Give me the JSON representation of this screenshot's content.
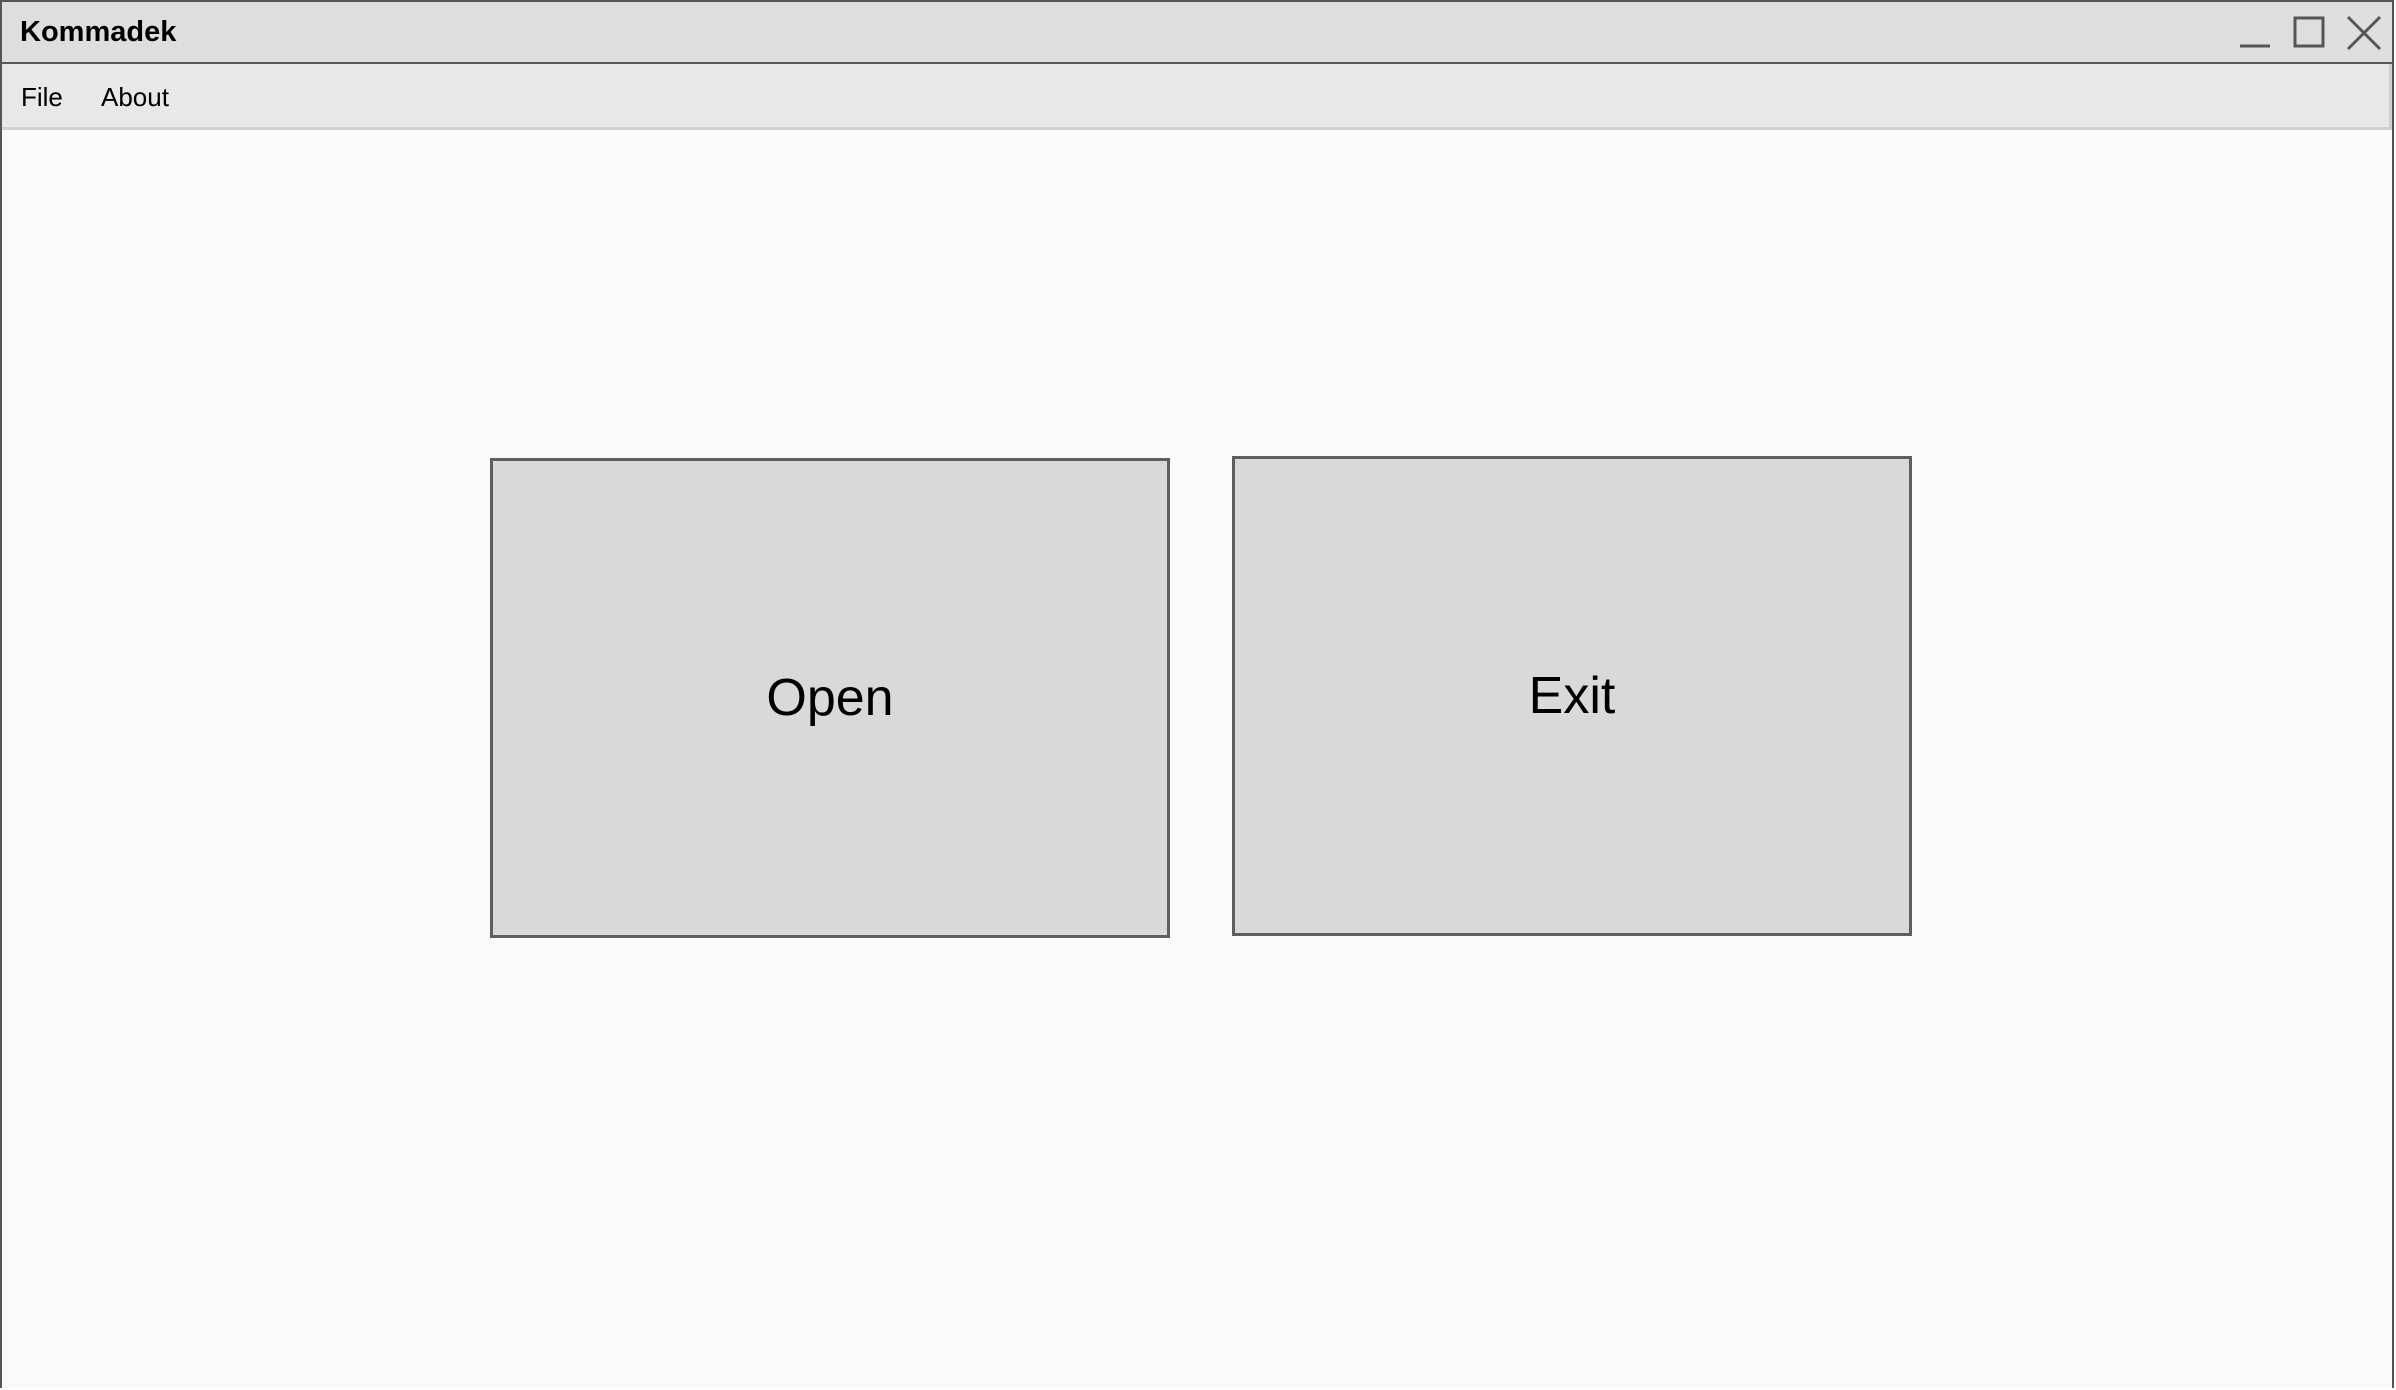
{
  "window": {
    "title": "Kommadek",
    "controls": {
      "minimize_icon": "minimize-icon",
      "maximize_icon": "maximize-icon",
      "close_icon": "close-icon"
    }
  },
  "menubar": {
    "items": [
      {
        "label": "File"
      },
      {
        "label": "About"
      }
    ]
  },
  "main": {
    "open_label": "Open",
    "exit_label": "Exit"
  },
  "colors": {
    "titlebar_bg": "#dedede",
    "menubar_bg": "#e8e8e8",
    "content_bg": "#fafafa",
    "button_bg": "#d9d9d9",
    "border": "#5f5f5f"
  }
}
